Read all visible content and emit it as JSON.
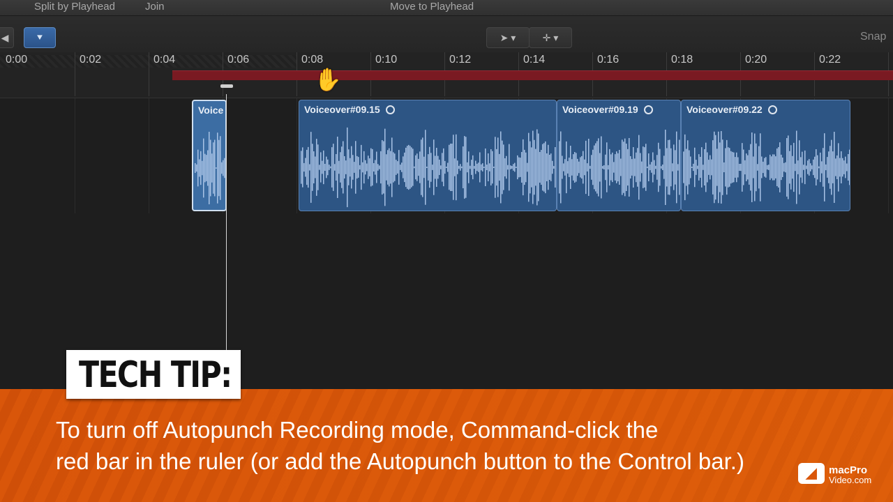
{
  "menubar": {
    "split": "Split by Playhead",
    "join": "Join",
    "move": "Move to Playhead"
  },
  "toolbar": {
    "snap": "Snap",
    "arrow_icon": "arrow-cursor-icon",
    "crosshair_icon": "crosshair-icon"
  },
  "ruler": {
    "ticks": [
      "0:00",
      "0:02",
      "0:04",
      "0:06",
      "0:08",
      "0:10",
      "0:12",
      "0:14",
      "0:16",
      "0:18",
      "0:20",
      "0:22"
    ]
  },
  "clips": {
    "c0": {
      "title": "Voice"
    },
    "c1": {
      "title": "Voiceover#09.15"
    },
    "c2": {
      "title": "Voiceover#09.19"
    },
    "c3": {
      "title": "Voiceover#09.22"
    }
  },
  "tip": {
    "label": "TECH TIP:",
    "line1": "To turn off Autopunch Recording mode, Command-click the",
    "line2": "red bar in the ruler (or add the Autopunch button to the Control bar.)"
  },
  "logo": {
    "line1": "macPro",
    "line2": "Video.com"
  },
  "colors": {
    "clip": "#2d5584",
    "redbar": "#7a1a22",
    "banner": "#d9560a"
  }
}
